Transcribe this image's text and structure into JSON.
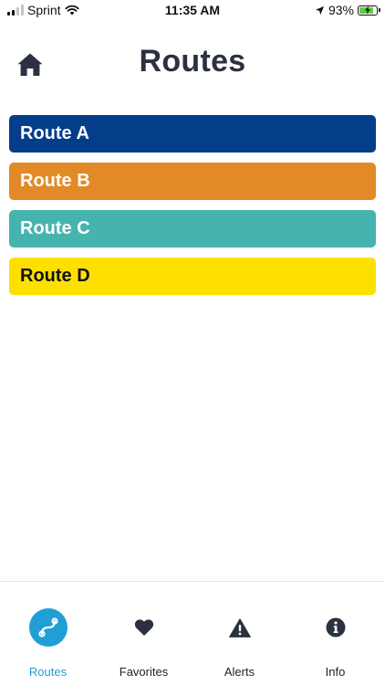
{
  "status_bar": {
    "carrier": "Sprint",
    "time": "11:35 AM",
    "battery": "93%",
    "battery_level": 0.93,
    "icons": [
      "signal-icon",
      "wifi-icon",
      "location-arrow-icon",
      "battery-charging-icon"
    ]
  },
  "header": {
    "title": "Routes",
    "home_icon": "home-icon"
  },
  "routes": [
    {
      "label": "Route A",
      "bg": "#043d8a",
      "fg": "#ffffff"
    },
    {
      "label": "Route B",
      "bg": "#e28a28",
      "fg": "#ffffff"
    },
    {
      "label": "Route C",
      "bg": "#46b4ae",
      "fg": "#ffffff"
    },
    {
      "label": "Route D",
      "bg": "#fde000",
      "fg": "#111111"
    }
  ],
  "tab_bar": {
    "active_color": "#1f9fd6",
    "tabs": [
      {
        "label": "Routes",
        "icon": "route-icon",
        "active": true
      },
      {
        "label": "Favorites",
        "icon": "heart-icon",
        "active": false
      },
      {
        "label": "Alerts",
        "icon": "warning-icon",
        "active": false
      },
      {
        "label": "Info",
        "icon": "info-icon",
        "active": false
      }
    ]
  }
}
